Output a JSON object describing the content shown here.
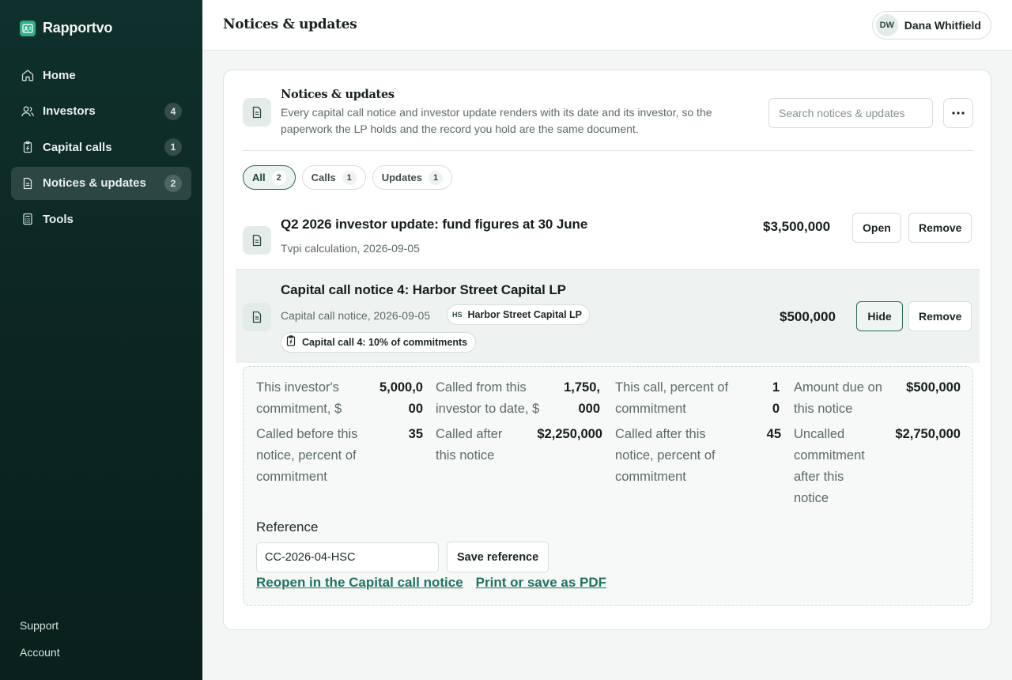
{
  "app": {
    "name": "Rapportvo"
  },
  "sidebar": {
    "items": [
      {
        "label": "Home",
        "icon": "home-icon"
      },
      {
        "label": "Investors",
        "count": "4",
        "icon": "users-icon"
      },
      {
        "label": "Capital calls",
        "count": "1",
        "icon": "clipboard-icon"
      },
      {
        "label": "Notices & updates",
        "count": "2",
        "icon": "document-icon",
        "active": true
      },
      {
        "label": "Tools",
        "icon": "calculator-icon"
      }
    ],
    "support": "Support",
    "account": "Account"
  },
  "header": {
    "title": "Notices & updates",
    "user": {
      "initials": "DW",
      "name": "Dana Whitfield"
    }
  },
  "panel": {
    "title": "Notices & updates",
    "description": "Every capital call notice and investor update renders with its date and its investor, so the paperwork the LP holds and the record you hold are the same document.",
    "search_placeholder": "Search notices & updates"
  },
  "tabs": [
    {
      "label": "All",
      "count": "2",
      "active": true
    },
    {
      "label": "Calls",
      "count": "1"
    },
    {
      "label": "Updates",
      "count": "1"
    }
  ],
  "notices": [
    {
      "title": "Q2 2026 investor update: fund figures at 30 June",
      "subtitle": "Tvpi calculation, 2026-09-05",
      "amount": "$3,500,000",
      "open_label": "Open",
      "remove_label": "Remove"
    },
    {
      "title": "Capital call notice 4: Harbor Street Capital LP",
      "subtitle": "Capital call notice, 2026-09-05",
      "investor_initials": "HS",
      "investor_name": "Harbor Street Capital LP",
      "call_chip": "Capital call 4: 10% of commitments",
      "amount": "$500,000",
      "hide_label": "Hide",
      "remove_label": "Remove"
    }
  ],
  "detail": {
    "facts": [
      {
        "label": "This investor's commitment, $",
        "value": "5,000,000"
      },
      {
        "label": "Called from this investor to date, $",
        "value": "1,750,000"
      },
      {
        "label": "This call, percent of commitment",
        "value": "10"
      },
      {
        "label": "Amount due on this notice",
        "value": "$500,000"
      },
      {
        "label": "Called before this notice, percent of commitment",
        "value": "35"
      },
      {
        "label": "Called after this notice",
        "value": "$2,250,000"
      },
      {
        "label": "Called after this notice, percent of commitment",
        "value": "45"
      },
      {
        "label": "Uncalled commitment after this notice",
        "value": "$2,750,000"
      }
    ],
    "reference_label": "Reference",
    "reference_value": "CC-2026-04-HSC",
    "save_reference": "Save reference",
    "reopen_link": "Reopen in the Capital call notice",
    "print_link": "Print or save as PDF"
  },
  "colors": {
    "sidebar_bg": "#0b2521",
    "accent": "#1f7363",
    "brand": "#2fae8a"
  }
}
